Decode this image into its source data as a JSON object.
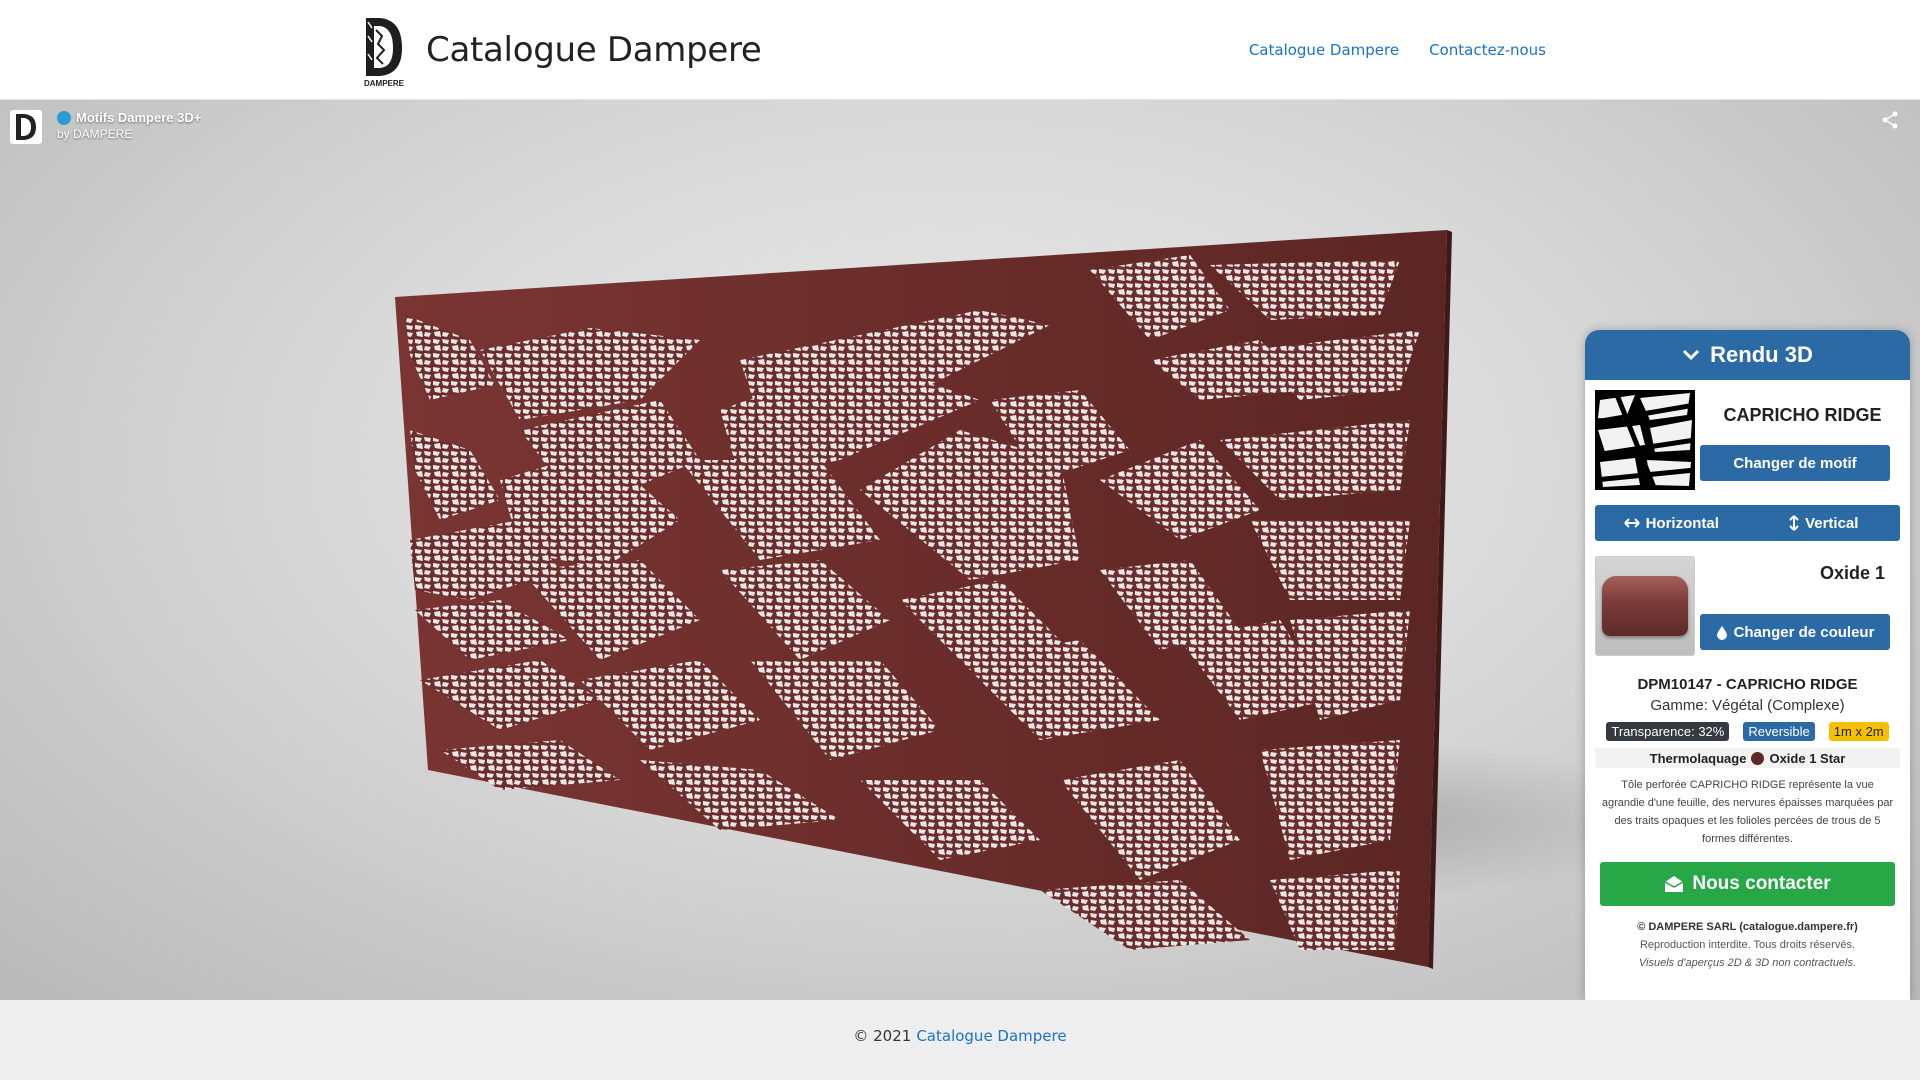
{
  "header": {
    "logo_caption": "DAMPERE",
    "title": "Catalogue Dampere",
    "nav": [
      "Catalogue Dampere",
      "Contactez-nous"
    ]
  },
  "viewer": {
    "model_title": "Motifs Dampere 3D+",
    "author": "by DAMPERE",
    "panel_color": "#6e2e2c"
  },
  "side": {
    "header": "Rendu 3D",
    "motif_name": "CAPRICHO RIDGE",
    "change_motif": "Changer de motif",
    "horizontal": "Horizontal",
    "vertical": "Vertical",
    "color_name": "Oxide 1",
    "change_color": "Changer de couleur",
    "reference": "DPM10147 - CAPRICHO RIDGE",
    "gamme": "Gamme: Végétal (Complexe)",
    "badges": [
      "Transparence: 32%",
      "Reversible",
      "1m x 2m"
    ],
    "thermo_label": "Thermolaquage",
    "thermo_color": "Oxide 1 Star",
    "description": "Tôle perforée CAPRICHO RIDGE représente la vue agrandie d'une feuille, des nervures épaisses marquées par des traits opaques et les folioles percées de trous de 5 formes différentes.",
    "contact": "Nous contacter",
    "legal_1": "© DAMPERE SARL (catalogue.dampere.fr)",
    "legal_2": "Reproduction interdite. Tous droits réservés.",
    "legal_3": "Visuels d'aperçus 2D & 3D non contractuels."
  },
  "footer": {
    "copyright": "© 2021",
    "link": "Catalogue Dampere"
  }
}
